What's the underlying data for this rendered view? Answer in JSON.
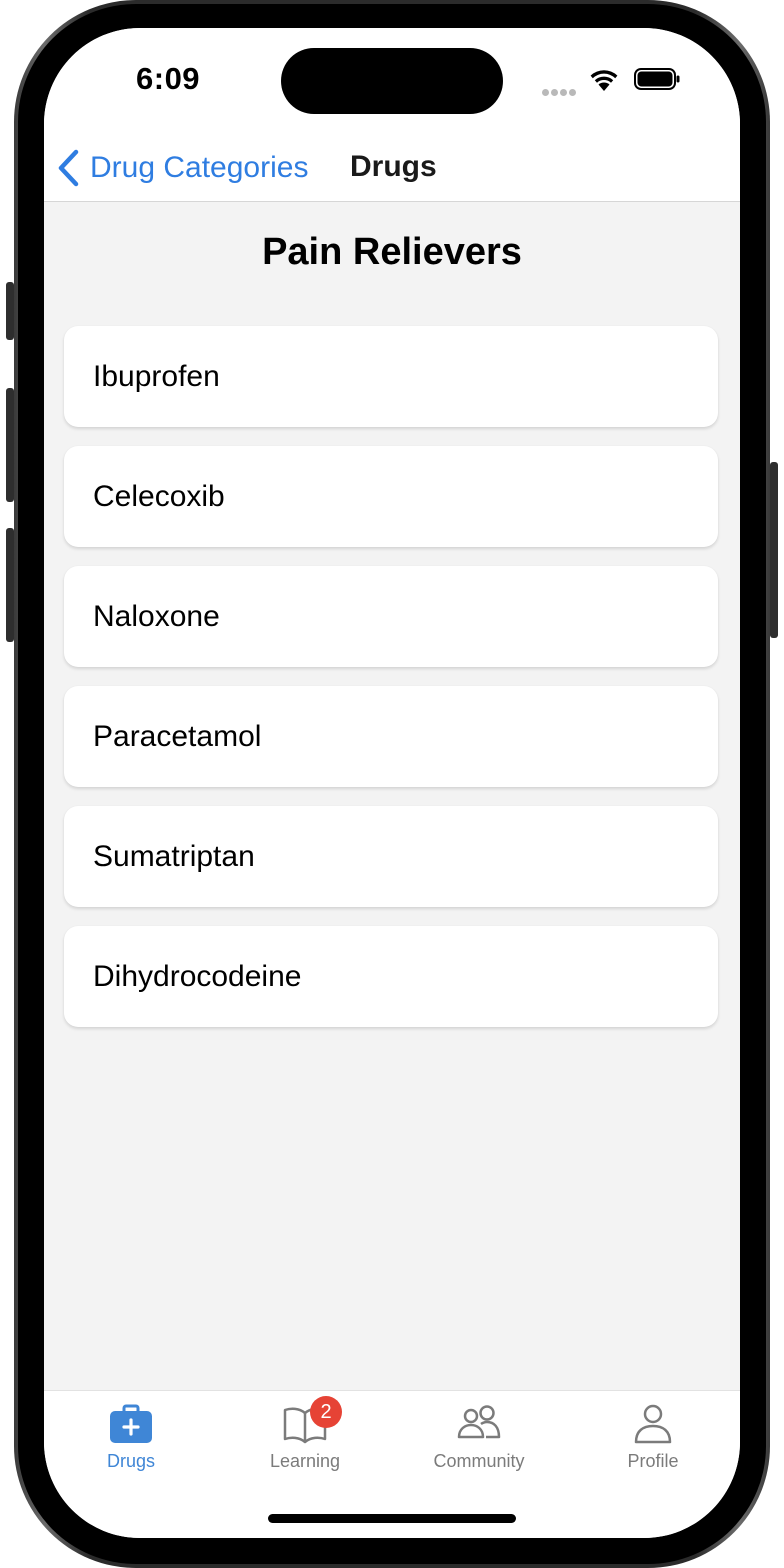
{
  "status_bar": {
    "time": "6:09"
  },
  "nav": {
    "back_label": "Drug Categories",
    "title": "Drugs"
  },
  "page": {
    "title": "Pain Relievers"
  },
  "drugs": [
    {
      "name": "Ibuprofen"
    },
    {
      "name": "Celecoxib"
    },
    {
      "name": "Naloxone"
    },
    {
      "name": "Paracetamol"
    },
    {
      "name": "Sumatriptan"
    },
    {
      "name": "Dihydrocodeine"
    }
  ],
  "tab_bar": {
    "tabs": [
      {
        "label": "Drugs",
        "icon": "medical-kit-icon",
        "active": true
      },
      {
        "label": "Learning",
        "icon": "book-icon",
        "badge": "2"
      },
      {
        "label": "Community",
        "icon": "people-icon"
      },
      {
        "label": "Profile",
        "icon": "person-icon"
      }
    ]
  },
  "colors": {
    "accent": "#2f7de1",
    "badge": "#e64335",
    "tab_inactive": "#7b7b7b",
    "background": "#f3f3f3"
  }
}
